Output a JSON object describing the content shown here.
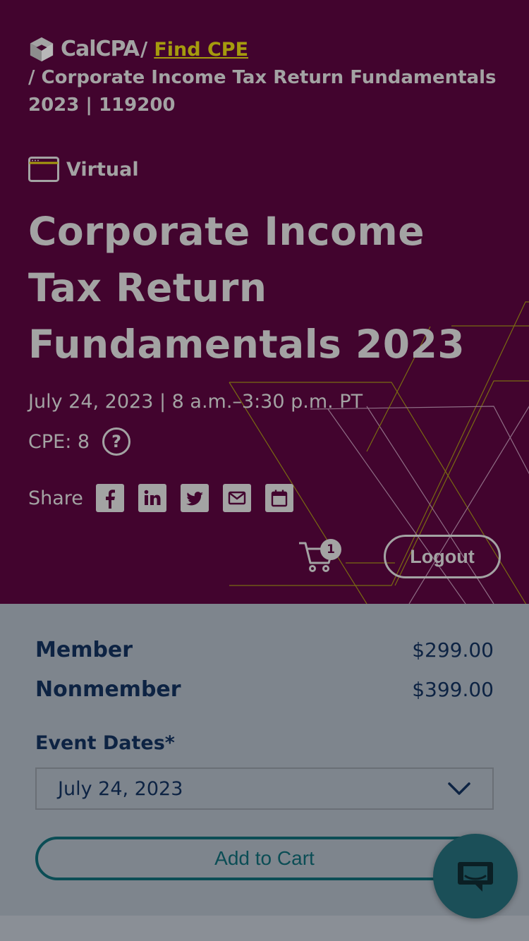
{
  "breadcrumb": {
    "logo_text": "CalCPA",
    "separator": "/",
    "link_label": "Find CPE",
    "current": "/ Corporate Income Tax Return Fundamentals 2023 | 119200"
  },
  "event": {
    "format": "Virtual",
    "title": "Corporate Income Tax Return Fundamentals 2023",
    "date_time": "July 24, 2023 | 8 a.m.–3:30 p.m. PT",
    "cpe": "CPE: 8",
    "help_glyph": "?"
  },
  "share": {
    "label": "Share",
    "icons": [
      "facebook-icon",
      "linkedin-icon",
      "twitter-icon",
      "email-icon",
      "calendar-icon"
    ]
  },
  "header_actions": {
    "cart_count": "1",
    "logout_label": "Logout"
  },
  "pricing": [
    {
      "name": "Member",
      "price": "$299.00"
    },
    {
      "name": "Nonmember",
      "price": "$399.00"
    }
  ],
  "form": {
    "event_dates_label": "Event Dates*",
    "selected_date": "July 24, 2023",
    "add_to_cart_label": "Add to Cart"
  },
  "colors": {
    "hero_bg": "#42042e",
    "accent_link": "#a59b0e",
    "navy_text": "#0d2343",
    "teal": "#0b4d55"
  }
}
